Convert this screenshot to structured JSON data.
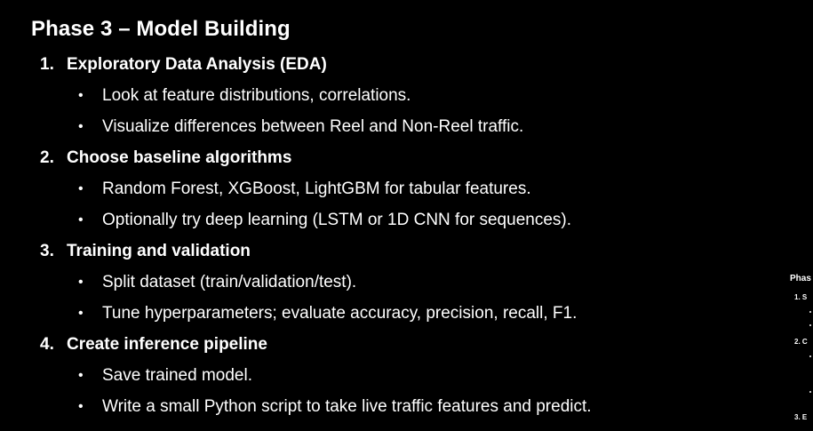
{
  "document": {
    "heading": "Phase 3 – Model Building",
    "steps": [
      {
        "number": "1.",
        "title": "Exploratory Data Analysis (EDA)",
        "bullets": [
          "Look at feature distributions, correlations.",
          "Visualize differences between Reel and Non-Reel traffic."
        ]
      },
      {
        "number": "2.",
        "title": "Choose baseline algorithms",
        "bullets": [
          "Random Forest, XGBoost, LightGBM for tabular features.",
          "Optionally try deep learning (LSTM or 1D CNN for sequences)."
        ]
      },
      {
        "number": "3.",
        "title": "Training and validation",
        "bullets": [
          "Split dataset (train/validation/test).",
          "Tune hyperparameters; evaluate accuracy, precision, recall, F1."
        ]
      },
      {
        "number": "4.",
        "title": "Create inference pipeline",
        "bullets": [
          "Save trained model.",
          "Write a small Python script to take live traffic features and predict."
        ]
      }
    ],
    "bullet_glyph": "•"
  },
  "side_panel": {
    "title": "Phas",
    "items": [
      "1. S",
      "2. C",
      "3. E"
    ]
  }
}
